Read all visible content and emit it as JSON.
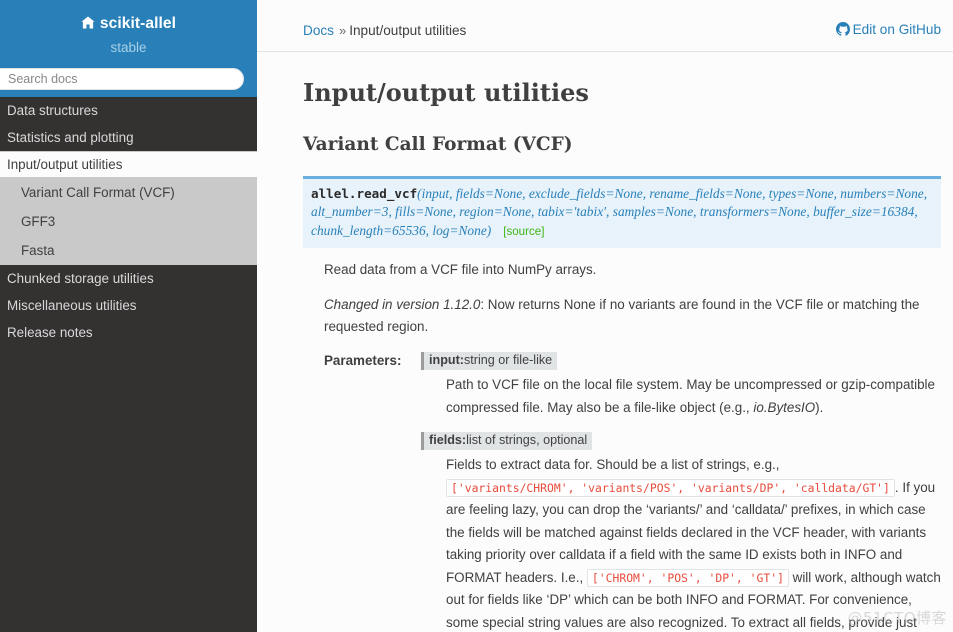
{
  "sidebar": {
    "brand": {
      "icon": "home-icon",
      "title": "scikit-allel",
      "version": "stable"
    },
    "search": {
      "placeholder": "Search docs",
      "value": ""
    },
    "nav": [
      {
        "label": "Data structures",
        "current": false
      },
      {
        "label": "Statistics and plotting",
        "current": false
      },
      {
        "label": "Input/output utilities",
        "current": true,
        "children": [
          {
            "label": "Variant Call Format (VCF)"
          },
          {
            "label": "GFF3"
          },
          {
            "label": "Fasta"
          }
        ]
      },
      {
        "label": "Chunked storage utilities",
        "current": false
      },
      {
        "label": "Miscellaneous utilities",
        "current": false
      },
      {
        "label": "Release notes",
        "current": false
      }
    ],
    "colors": {
      "header_bg": "#2980b9",
      "nav_bg": "#343131",
      "sub_bg": "#c9c9c9"
    }
  },
  "breadcrumb": {
    "root_label": "Docs",
    "separator": "»",
    "current_label": "Input/output utilities",
    "edit_link": {
      "icon": "github-icon",
      "label": "Edit on GitHub"
    }
  },
  "main": {
    "h1": "Input/output utilities",
    "h2": "Variant Call Format (VCF)",
    "signature": {
      "name": "allel.read_vcf",
      "params": "(input, fields=None, exclude_fields=None, rename_fields=None, types=None, numbers=None, alt_number=3, fills=None, region=None, tabix='tabix', samples=None, transformers=None, buffer_size=16384, chunk_length=65536, log=None)",
      "source_label": "[source]",
      "accent_border": "#6ab0de",
      "accent_bg": "#e7f2fa"
    },
    "summary": "Read data from a VCF file into NumPy arrays.",
    "version_changed": {
      "prefix": "Changed in version 1.12.0",
      "text": ": Now returns None if no variants are found in the VCF file or matching the requested region."
    },
    "fields_label": "Parameters:",
    "parameters": [
      {
        "name": "input",
        "type": "string or file-like",
        "desc_parts": [
          {
            "kind": "text",
            "text": "Path to VCF file on the local file system. May be uncompressed or gzip-compatible compressed file. May also be a file-like object (e.g., "
          },
          {
            "kind": "em",
            "text": "io.BytesIO"
          },
          {
            "kind": "text",
            "text": ")."
          }
        ]
      },
      {
        "name": "fields",
        "type": "list of strings, optional",
        "desc_parts": [
          {
            "kind": "text",
            "text": "Fields to extract data for. Should be a list of strings, e.g., "
          },
          {
            "kind": "code",
            "text": "['variants/CHROM', 'variants/POS', 'variants/DP', 'calldata/GT']"
          },
          {
            "kind": "text",
            "text": ". If you are feeling lazy, you can drop the ‘variants/’ and ‘calldata/’ prefixes, in which case the fields will be matched against fields declared in the VCF header, with variants taking priority over calldata if a field with the same ID exists both in INFO and FORMAT headers. I.e., "
          },
          {
            "kind": "code",
            "text": "['CHROM', 'POS', 'DP', 'GT']"
          },
          {
            "kind": "text",
            "text": " will work, although watch out for fields like ‘DP’ which can be both INFO and FORMAT. For convenience, some special string values are also recognized. To extract all fields, provide just"
          }
        ]
      }
    ]
  },
  "watermark": "@51CTO博客"
}
